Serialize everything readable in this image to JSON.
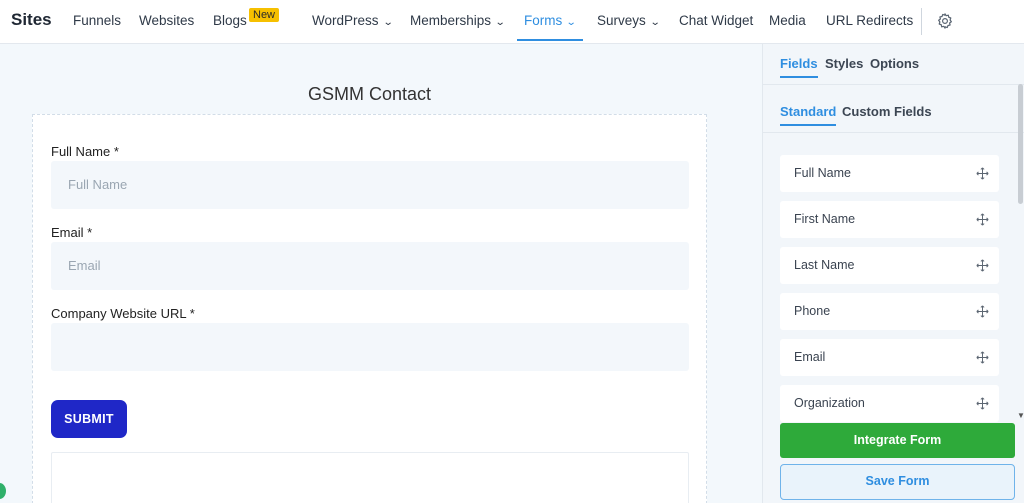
{
  "nav": {
    "brand": "Sites",
    "items": [
      {
        "label": "Funnels"
      },
      {
        "label": "Websites"
      },
      {
        "label": "Blogs",
        "badge": "New"
      },
      {
        "label": "WordPress"
      },
      {
        "label": "Memberships"
      },
      {
        "label": "Forms"
      },
      {
        "label": "Surveys"
      },
      {
        "label": "Chat Widget"
      },
      {
        "label": "Media"
      },
      {
        "label": "URL Redirects"
      }
    ],
    "settings_icon": "gear-icon",
    "accent": "#2f8ee0"
  },
  "form": {
    "title": "GSMM Contact",
    "fields": [
      {
        "label": "Full Name *",
        "placeholder": "Full Name"
      },
      {
        "label": "Email *",
        "placeholder": "Email"
      },
      {
        "label": "Company Website URL *",
        "placeholder": ""
      }
    ],
    "submit_label": "SUBMIT",
    "submit_color": "#1f27c7"
  },
  "panel": {
    "tabs": [
      {
        "label": "Fields"
      },
      {
        "label": "Styles"
      },
      {
        "label": "Options"
      }
    ],
    "subtabs": [
      {
        "label": "Standard"
      },
      {
        "label": "Custom Fields"
      }
    ],
    "field_items": [
      {
        "label": "Full Name"
      },
      {
        "label": "First Name"
      },
      {
        "label": "Last Name"
      },
      {
        "label": "Phone"
      },
      {
        "label": "Email"
      },
      {
        "label": "Organization"
      }
    ],
    "integrate_label": "Integrate Form",
    "integrate_color": "#2eaa3a",
    "save_label": "Save Form"
  }
}
